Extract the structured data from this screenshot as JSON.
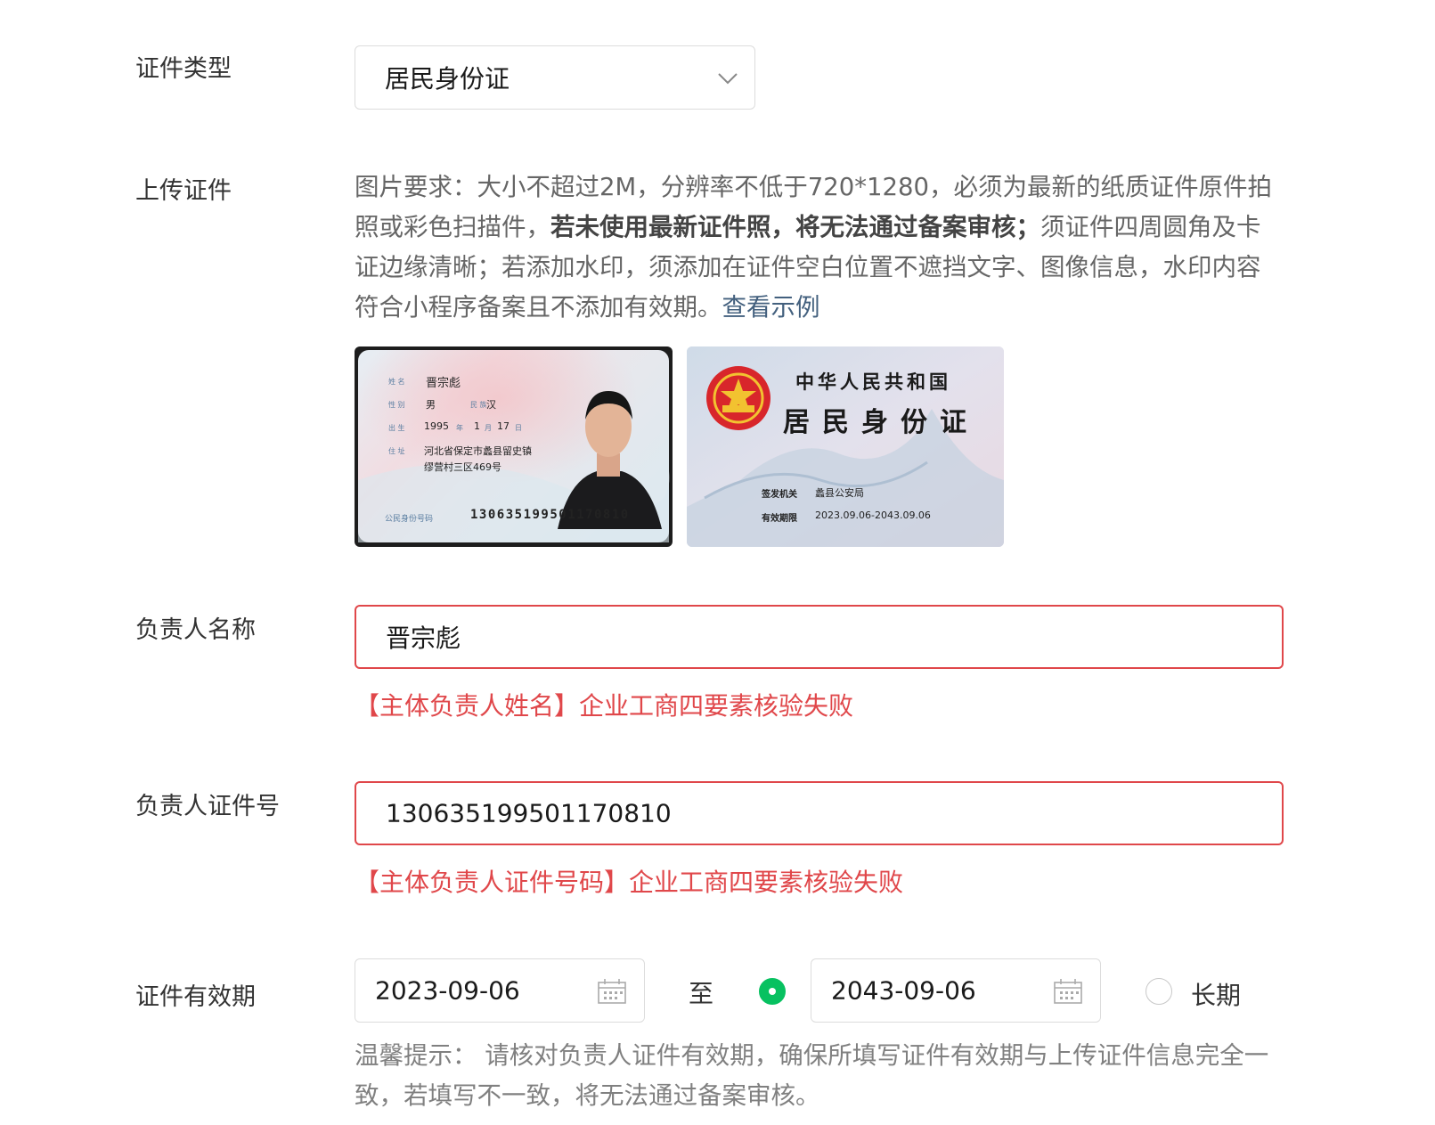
{
  "cert_type": {
    "label": "证件类型",
    "value": "居民身份证"
  },
  "upload": {
    "label": "上传证件",
    "req_1": "图片要求：大小不超过2M，分辨率不低于720*1280，必须为最新的纸质证件原件拍照或彩色扫描件，",
    "req_bold": "若未使用最新证件照，将无法通过备案审核；",
    "req_2": "须证件四周圆角及卡证边缘清晰；若添加水印，须添加在证件空白位置不遮挡文字、图像信息，水印内容符合小程序备案且不添加有效期。",
    "example_link": "查看示例",
    "front": {
      "name_lbl": "姓 名",
      "name": "晋宗彪",
      "sex_lbl": "性 别",
      "sex": "男",
      "nation_lbl": "民 族",
      "nation": "汉",
      "birth_lbl": "出 生",
      "birth_y": "1995",
      "year_lbl": "年",
      "birth_m": "1",
      "month_lbl": "月",
      "birth_d": "17",
      "day_lbl": "日",
      "addr_lbl": "住 址",
      "addr_1": "河北省保定市蠡县留史镇",
      "addr_2": "缪营村三区469号",
      "id_lbl": "公民身份号码",
      "id": "130635199501170810"
    },
    "back": {
      "country": "中华人民共和国",
      "title": "居民身份证",
      "authority_lbl": "签发机关",
      "authority": "蠡县公安局",
      "validity_lbl": "有效期限",
      "validity": "2023.09.06-2043.09.06"
    }
  },
  "owner_name": {
    "label": "负责人名称",
    "value": "晋宗彪",
    "error": "【主体负责人姓名】企业工商四要素核验失败"
  },
  "owner_id": {
    "label": "负责人证件号",
    "value": "130635199501170810",
    "error": "【主体负责人证件号码】企业工商四要素核验失败"
  },
  "validity": {
    "label": "证件有效期",
    "start": "2023-09-06",
    "to": "至",
    "end": "2043-09-06",
    "long_term": "长期",
    "tip": "温馨提示： 请核对负责人证件有效期，确保所填写证件有效期与上传证件信息完全一致，若填写不一致，将无法通过备案审核。"
  },
  "colors": {
    "error": "#e0474a",
    "accent": "#07c160",
    "link": "#43607e"
  }
}
